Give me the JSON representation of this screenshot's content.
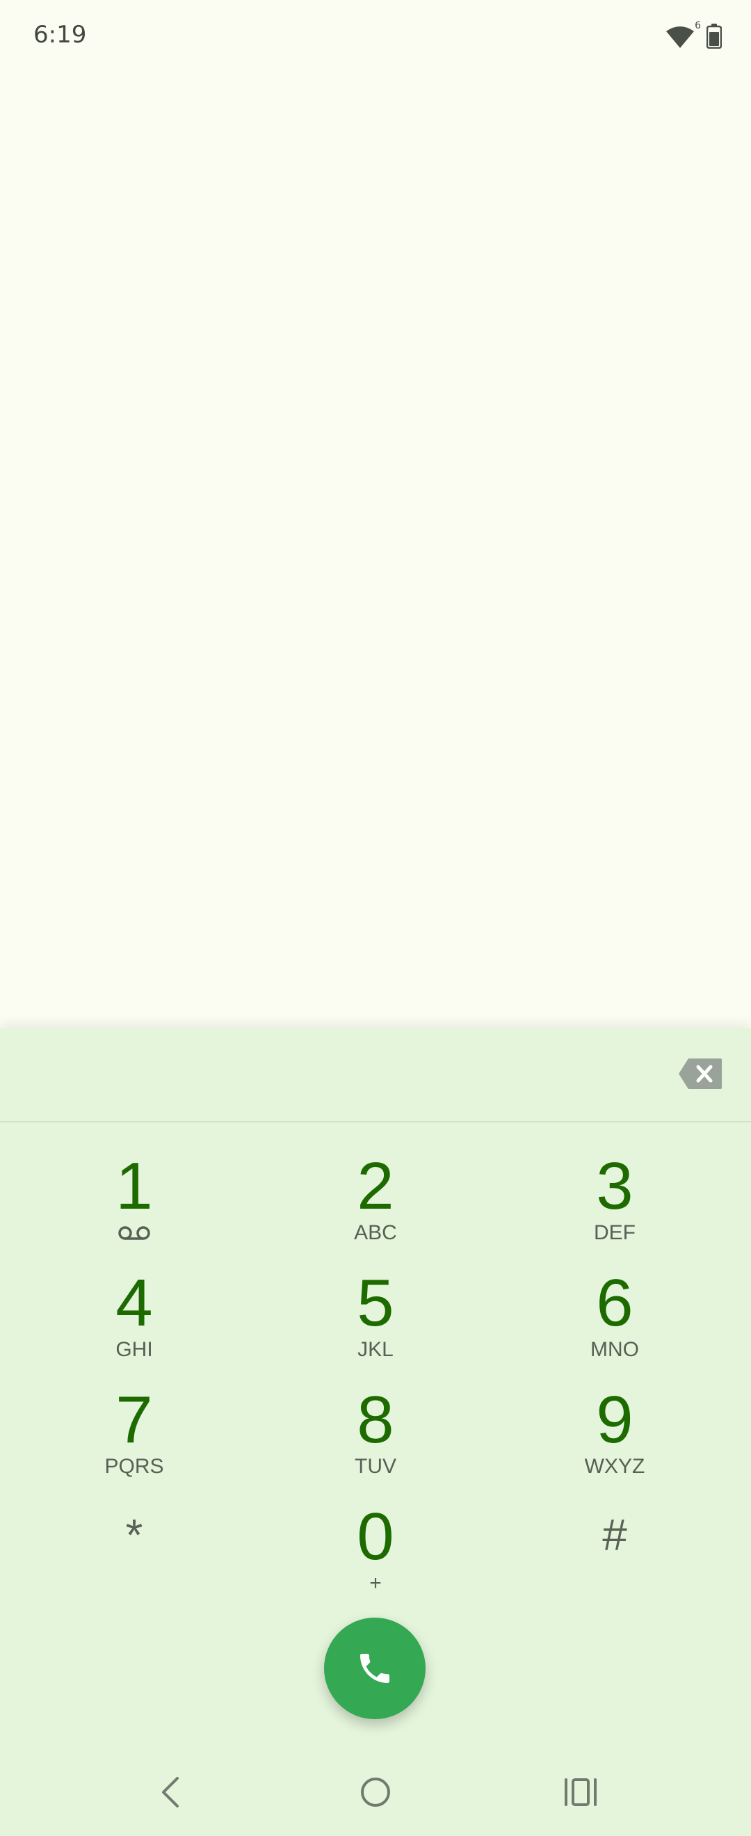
{
  "status_bar": {
    "time": "6:19",
    "icons": [
      "wifi-icon",
      "battery-icon"
    ],
    "wifi_badge": "6"
  },
  "dialer": {
    "digits_value": "",
    "backspace_icon": "backspace-icon",
    "keys": [
      {
        "digit": "1",
        "letters": "",
        "sub_icon": "voicemail-icon"
      },
      {
        "digit": "2",
        "letters": "ABC"
      },
      {
        "digit": "3",
        "letters": "DEF"
      },
      {
        "digit": "4",
        "letters": "GHI"
      },
      {
        "digit": "5",
        "letters": "JKL"
      },
      {
        "digit": "6",
        "letters": "MNO"
      },
      {
        "digit": "7",
        "letters": "PQRS"
      },
      {
        "digit": "8",
        "letters": "TUV"
      },
      {
        "digit": "9",
        "letters": "WXYZ"
      },
      {
        "digit": "*",
        "letters": ""
      },
      {
        "digit": "0",
        "letters": "+"
      },
      {
        "digit": "#",
        "letters": ""
      }
    ],
    "call_icon": "phone-icon"
  },
  "nav_bar": {
    "icons": [
      "back-icon",
      "home-icon",
      "recents-icon"
    ]
  },
  "colors": {
    "background": "#fbfdf3",
    "panel": "#e5f5dc",
    "digit": "#1d6b00",
    "call_button": "#34a853"
  }
}
